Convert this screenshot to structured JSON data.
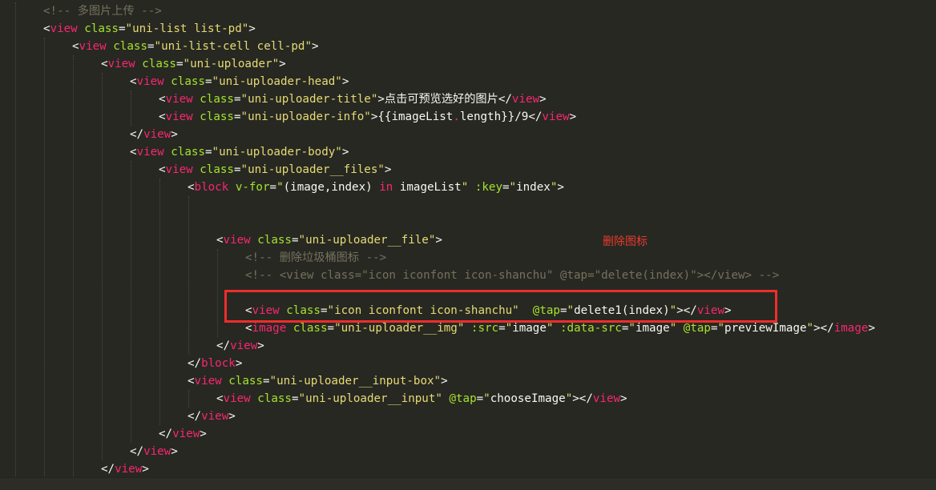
{
  "annotation": {
    "label": "删除图标"
  },
  "code_lines": [
    {
      "indent": 2,
      "tokens": [
        [
          "comment",
          "<!-- 多图片上传 -->"
        ]
      ]
    },
    {
      "indent": 2,
      "tokens": [
        [
          "punct",
          "<"
        ],
        [
          "tag",
          "view"
        ],
        [
          "text",
          " "
        ],
        [
          "attr",
          "class"
        ],
        [
          "punct",
          "="
        ],
        [
          "str",
          "\"uni-list list-pd\""
        ],
        [
          "punct",
          ">"
        ]
      ]
    },
    {
      "indent": 3,
      "tokens": [
        [
          "punct",
          "<"
        ],
        [
          "tag",
          "view"
        ],
        [
          "text",
          " "
        ],
        [
          "attr",
          "class"
        ],
        [
          "punct",
          "="
        ],
        [
          "str",
          "\"uni-list-cell cell-pd\""
        ],
        [
          "punct",
          ">"
        ]
      ]
    },
    {
      "indent": 4,
      "tokens": [
        [
          "punct",
          "<"
        ],
        [
          "tag",
          "view"
        ],
        [
          "text",
          " "
        ],
        [
          "attr",
          "class"
        ],
        [
          "punct",
          "="
        ],
        [
          "str",
          "\"uni-uploader\""
        ],
        [
          "punct",
          ">"
        ]
      ]
    },
    {
      "indent": 5,
      "tokens": [
        [
          "punct",
          "<"
        ],
        [
          "tag",
          "view"
        ],
        [
          "text",
          " "
        ],
        [
          "attr",
          "class"
        ],
        [
          "punct",
          "="
        ],
        [
          "str",
          "\"uni-uploader-head\""
        ],
        [
          "punct",
          ">"
        ]
      ]
    },
    {
      "indent": 6,
      "tokens": [
        [
          "punct",
          "<"
        ],
        [
          "tag",
          "view"
        ],
        [
          "text",
          " "
        ],
        [
          "attr",
          "class"
        ],
        [
          "punct",
          "="
        ],
        [
          "str",
          "\"uni-uploader-title\""
        ],
        [
          "punct",
          ">"
        ],
        [
          "text",
          "点击可预览选好的图片"
        ],
        [
          "punct",
          "</"
        ],
        [
          "tag",
          "view"
        ],
        [
          "punct",
          ">"
        ]
      ]
    },
    {
      "indent": 6,
      "tokens": [
        [
          "punct",
          "<"
        ],
        [
          "tag",
          "view"
        ],
        [
          "text",
          " "
        ],
        [
          "attr",
          "class"
        ],
        [
          "punct",
          "="
        ],
        [
          "str",
          "\"uni-uploader-info\""
        ],
        [
          "punct",
          ">"
        ],
        [
          "text",
          "{{imageList"
        ],
        [
          "kw",
          "."
        ],
        [
          "text",
          "length}}/9"
        ],
        [
          "punct",
          "</"
        ],
        [
          "tag",
          "view"
        ],
        [
          "punct",
          ">"
        ]
      ]
    },
    {
      "indent": 5,
      "tokens": [
        [
          "punct",
          "</"
        ],
        [
          "tag",
          "view"
        ],
        [
          "punct",
          ">"
        ]
      ]
    },
    {
      "indent": 5,
      "tokens": [
        [
          "punct",
          "<"
        ],
        [
          "tag",
          "view"
        ],
        [
          "text",
          " "
        ],
        [
          "attr",
          "class"
        ],
        [
          "punct",
          "="
        ],
        [
          "str",
          "\"uni-uploader-body\""
        ],
        [
          "punct",
          ">"
        ]
      ]
    },
    {
      "indent": 6,
      "tokens": [
        [
          "punct",
          "<"
        ],
        [
          "tag",
          "view"
        ],
        [
          "text",
          " "
        ],
        [
          "attr",
          "class"
        ],
        [
          "punct",
          "="
        ],
        [
          "str",
          "\"uni-uploader__files\""
        ],
        [
          "punct",
          ">"
        ]
      ]
    },
    {
      "indent": 7,
      "tokens": [
        [
          "punct",
          "<"
        ],
        [
          "tag",
          "block"
        ],
        [
          "text",
          " "
        ],
        [
          "attr",
          "v-for"
        ],
        [
          "punct",
          "="
        ],
        [
          "str",
          "\""
        ],
        [
          "text",
          "(image,index) "
        ],
        [
          "kw",
          "in"
        ],
        [
          "text",
          " imageList"
        ],
        [
          "str",
          "\""
        ],
        [
          "text",
          " "
        ],
        [
          "attr",
          ":key"
        ],
        [
          "punct",
          "="
        ],
        [
          "str",
          "\""
        ],
        [
          "text",
          "index"
        ],
        [
          "str",
          "\""
        ],
        [
          "punct",
          ">"
        ]
      ]
    },
    {
      "indent": 8,
      "tokens": []
    },
    {
      "indent": 8,
      "tokens": []
    },
    {
      "indent": 8,
      "tokens": [
        [
          "punct",
          "<"
        ],
        [
          "tag",
          "view"
        ],
        [
          "text",
          " "
        ],
        [
          "attr",
          "class"
        ],
        [
          "punct",
          "="
        ],
        [
          "str",
          "\"uni-uploader__file\""
        ],
        [
          "punct",
          ">"
        ]
      ]
    },
    {
      "indent": 9,
      "tokens": [
        [
          "comment",
          "<!-- 删除垃圾桶图标 -->"
        ]
      ]
    },
    {
      "indent": 9,
      "tokens": [
        [
          "comment",
          "<!-- <view class=\"icon iconfont icon-shanchu\" @tap=\"delete(index)\"></view> -->"
        ]
      ]
    },
    {
      "indent": 9,
      "tokens": []
    },
    {
      "indent": 9,
      "tokens": [
        [
          "punct",
          "<"
        ],
        [
          "tag",
          "view"
        ],
        [
          "text",
          " "
        ],
        [
          "attr",
          "class"
        ],
        [
          "punct",
          "="
        ],
        [
          "str",
          "\"icon iconfont icon-shanchu\""
        ],
        [
          "text",
          "  "
        ],
        [
          "attr",
          "@tap"
        ],
        [
          "punct",
          "="
        ],
        [
          "str",
          "\""
        ],
        [
          "text",
          "delete1(index)"
        ],
        [
          "str",
          "\""
        ],
        [
          "punct",
          "></"
        ],
        [
          "tag",
          "view"
        ],
        [
          "punct",
          ">"
        ]
      ]
    },
    {
      "indent": 9,
      "tokens": [
        [
          "punct",
          "<"
        ],
        [
          "tag",
          "image"
        ],
        [
          "text",
          " "
        ],
        [
          "attr",
          "class"
        ],
        [
          "punct",
          "="
        ],
        [
          "str",
          "\"uni-uploader__img\""
        ],
        [
          "text",
          " "
        ],
        [
          "attr",
          ":src"
        ],
        [
          "punct",
          "="
        ],
        [
          "str",
          "\""
        ],
        [
          "text",
          "image"
        ],
        [
          "str",
          "\""
        ],
        [
          "text",
          " "
        ],
        [
          "attr",
          ":data-src"
        ],
        [
          "punct",
          "="
        ],
        [
          "str",
          "\""
        ],
        [
          "text",
          "image"
        ],
        [
          "str",
          "\""
        ],
        [
          "text",
          " "
        ],
        [
          "attr",
          "@tap"
        ],
        [
          "punct",
          "="
        ],
        [
          "str",
          "\""
        ],
        [
          "text",
          "previewImage"
        ],
        [
          "str",
          "\""
        ],
        [
          "punct",
          "></"
        ],
        [
          "tag",
          "image"
        ],
        [
          "punct",
          ">"
        ]
      ]
    },
    {
      "indent": 8,
      "tokens": [
        [
          "punct",
          "</"
        ],
        [
          "tag",
          "view"
        ],
        [
          "punct",
          ">"
        ]
      ]
    },
    {
      "indent": 7,
      "tokens": [
        [
          "punct",
          "</"
        ],
        [
          "tag",
          "block"
        ],
        [
          "punct",
          ">"
        ]
      ]
    },
    {
      "indent": 7,
      "tokens": [
        [
          "punct",
          "<"
        ],
        [
          "tag",
          "view"
        ],
        [
          "text",
          " "
        ],
        [
          "attr",
          "class"
        ],
        [
          "punct",
          "="
        ],
        [
          "str",
          "\"uni-uploader__input-box\""
        ],
        [
          "punct",
          ">"
        ]
      ]
    },
    {
      "indent": 8,
      "tokens": [
        [
          "punct",
          "<"
        ],
        [
          "tag",
          "view"
        ],
        [
          "text",
          " "
        ],
        [
          "attr",
          "class"
        ],
        [
          "punct",
          "="
        ],
        [
          "str",
          "\"uni-uploader__input\""
        ],
        [
          "text",
          " "
        ],
        [
          "attr",
          "@tap"
        ],
        [
          "punct",
          "="
        ],
        [
          "str",
          "\""
        ],
        [
          "text",
          "chooseImage"
        ],
        [
          "str",
          "\""
        ],
        [
          "punct",
          "></"
        ],
        [
          "tag",
          "view"
        ],
        [
          "punct",
          ">"
        ]
      ]
    },
    {
      "indent": 7,
      "tokens": [
        [
          "punct",
          "</"
        ],
        [
          "tag",
          "view"
        ],
        [
          "punct",
          ">"
        ]
      ]
    },
    {
      "indent": 6,
      "tokens": [
        [
          "punct",
          "</"
        ],
        [
          "tag",
          "view"
        ],
        [
          "punct",
          ">"
        ]
      ]
    },
    {
      "indent": 5,
      "tokens": [
        [
          "punct",
          "</"
        ],
        [
          "tag",
          "view"
        ],
        [
          "punct",
          ">"
        ]
      ]
    },
    {
      "indent": 4,
      "tokens": [
        [
          "punct",
          "</"
        ],
        [
          "tag",
          "view"
        ],
        [
          "punct",
          ">"
        ]
      ]
    }
  ],
  "colors": {
    "background": "#272822",
    "tag": "#f92672",
    "attribute": "#a6e22e",
    "string": "#e6db74",
    "comment": "#75715e",
    "text": "#f8f8f2",
    "highlight_box": "#ee2d2d",
    "annotation": "#e83a2f"
  }
}
